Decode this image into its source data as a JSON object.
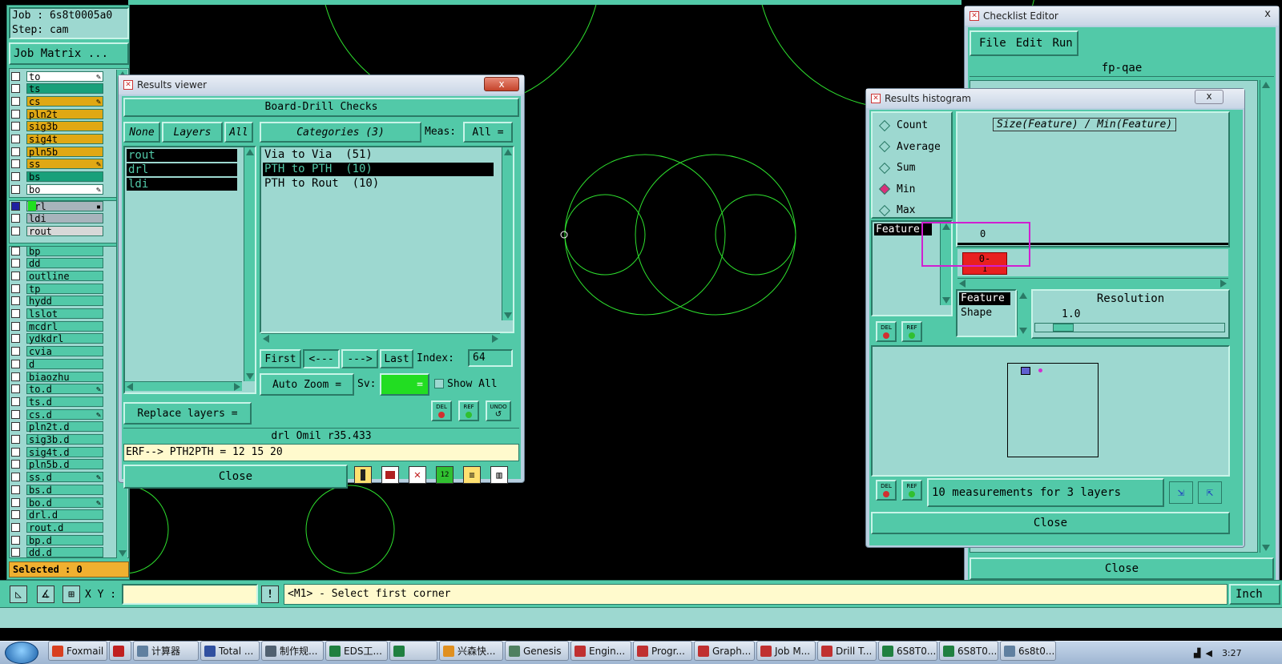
{
  "job_panel": {
    "job": "Job : 6s8t0005a0",
    "step": "Step: cam",
    "job_matrix_button": "Job Matrix ...",
    "selected": "Selected : 0",
    "layers_top": [
      {
        "name": "to",
        "color": "#ffffff",
        "mark": "✎"
      },
      {
        "name": "ts",
        "color": "#18a07a",
        "mark": ""
      },
      {
        "name": "cs",
        "color": "#e0a814",
        "mark": "✎"
      },
      {
        "name": "pln2t",
        "color": "#e0a814",
        "mark": ""
      },
      {
        "name": "sig3b",
        "color": "#e0a814",
        "mark": ""
      },
      {
        "name": "sig4t",
        "color": "#e0a814",
        "mark": ""
      },
      {
        "name": "pln5b",
        "color": "#e0a814",
        "mark": ""
      },
      {
        "name": "ss",
        "color": "#e0a814",
        "mark": "✎"
      },
      {
        "name": "bs",
        "color": "#18a07a",
        "mark": ""
      },
      {
        "name": "bo",
        "color": "#ffffff",
        "mark": "✎"
      }
    ],
    "layers_drill": [
      {
        "name": "drl",
        "color": "#a8b4bc",
        "mark": "▪"
      },
      {
        "name": "ldi",
        "color": "#a8b4bc",
        "mark": ""
      },
      {
        "name": "rout",
        "color": "#d8d8d8",
        "mark": ""
      }
    ],
    "layers_misc": [
      {
        "name": "bp",
        "mark": ""
      },
      {
        "name": "dd",
        "mark": ""
      },
      {
        "name": "outline",
        "mark": ""
      },
      {
        "name": "tp",
        "mark": ""
      },
      {
        "name": "hydd",
        "mark": ""
      },
      {
        "name": "lslot",
        "mark": ""
      },
      {
        "name": "mcdrl",
        "mark": ""
      },
      {
        "name": "ydkdrl",
        "mark": ""
      },
      {
        "name": "cvia",
        "mark": ""
      },
      {
        "name": "d",
        "mark": ""
      },
      {
        "name": "biaozhu",
        "mark": ""
      },
      {
        "name": "to.d",
        "mark": "✎"
      },
      {
        "name": "ts.d",
        "mark": ""
      },
      {
        "name": "cs.d",
        "mark": "✎"
      },
      {
        "name": "pln2t.d",
        "mark": ""
      },
      {
        "name": "sig3b.d",
        "mark": ""
      },
      {
        "name": "sig4t.d",
        "mark": ""
      },
      {
        "name": "pln5b.d",
        "mark": ""
      },
      {
        "name": "ss.d",
        "mark": "✎"
      },
      {
        "name": "bs.d",
        "mark": ""
      },
      {
        "name": "bo.d",
        "mark": "✎"
      },
      {
        "name": "drl.d",
        "mark": ""
      },
      {
        "name": "rout.d",
        "mark": ""
      },
      {
        "name": "bp.d",
        "mark": ""
      },
      {
        "name": "dd.d",
        "mark": ""
      }
    ]
  },
  "results_viewer": {
    "title": "Results viewer",
    "close_x": "x",
    "heading": "Board-Drill Checks",
    "none_btn": "None",
    "layers_btn": "Layers",
    "all_btn": "All",
    "categories_btn": "Categories (3)",
    "meas_label": "Meas:",
    "meas_value": "All",
    "layers": [
      "rout",
      "drl",
      "ldi"
    ],
    "categories": [
      {
        "label": "Via to Via  (51)",
        "selected": false
      },
      {
        "label": "PTH to PTH  (10)",
        "selected": true
      },
      {
        "label": "PTH to Rout  (10)",
        "selected": false
      }
    ],
    "first_btn": "First",
    "prev_btn": "<---",
    "next_btn": "--->",
    "last_btn": "Last",
    "index_label": "Index:",
    "index_value": "64",
    "auto_zoom_btn": "Auto Zoom",
    "sv_label": "Sv:",
    "show_all_label": "Show All",
    "replace_layers_btn": "Replace layers",
    "del_label": "DEL",
    "ref_label": "REF",
    "undo_label": "UNDO",
    "status_line": "drl  Omil   r35.433",
    "erf_line": "ERF--> PTH2PTH = 12 15 20",
    "close_btn": "Close"
  },
  "checklist_editor": {
    "title": "Checklist Editor",
    "close_x": "x",
    "menu": [
      "File",
      "Edit",
      "Run"
    ],
    "checklist_name": "fp-qae",
    "close_btn": "Close"
  },
  "results_histogram": {
    "title": "Results histogram",
    "close_x": "x",
    "modes": [
      {
        "label": "Count",
        "selected": false
      },
      {
        "label": "Average",
        "selected": false
      },
      {
        "label": "Sum",
        "selected": false
      },
      {
        "label": "Min",
        "selected": true
      },
      {
        "label": "Max",
        "selected": false
      }
    ],
    "chart_title": "Size(Feature) / Min(Feature)",
    "list_item": "Feature",
    "axis_top": "0",
    "bar_label": "0-",
    "bar_sub": "1",
    "group_by": [
      "Feature",
      "Shape"
    ],
    "resolution_label": "Resolution",
    "resolution_value": "1.0",
    "measurements": "10 measurements for 3 layers",
    "del_label": "DEL",
    "ref_label": "REF",
    "close_btn": "Close"
  },
  "command_bar": {
    "xy_label": "X Y :",
    "xy_value": "",
    "excl": "!",
    "prompt": "<M1> - Select first corner",
    "units": "Inch"
  },
  "taskbar": {
    "items": [
      {
        "label": "Foxmail",
        "color": "#d84020"
      },
      {
        "label": "",
        "color": "#c02020"
      },
      {
        "label": "计算器",
        "color": "#6080a0"
      },
      {
        "label": "Total ...",
        "color": "#3050a0"
      },
      {
        "label": "制作规...",
        "color": "#506070"
      },
      {
        "label": "EDS工...",
        "color": "#208040"
      },
      {
        "label": "",
        "color": "#208040"
      },
      {
        "label": "兴森快...",
        "color": "#e09020"
      },
      {
        "label": "Genesis",
        "color": "#508060"
      },
      {
        "label": "Engin...",
        "color": "#c03030"
      },
      {
        "label": "Progr...",
        "color": "#c03030"
      },
      {
        "label": "Graph...",
        "color": "#c03030"
      },
      {
        "label": "Job M...",
        "color": "#c03030"
      },
      {
        "label": "Drill T...",
        "color": "#c03030"
      },
      {
        "label": "6S8T0...",
        "color": "#208040"
      },
      {
        "label": "6S8T0...",
        "color": "#208040"
      },
      {
        "label": "6s8t0...",
        "color": "#6080a0"
      }
    ],
    "clock": "3:27"
  }
}
